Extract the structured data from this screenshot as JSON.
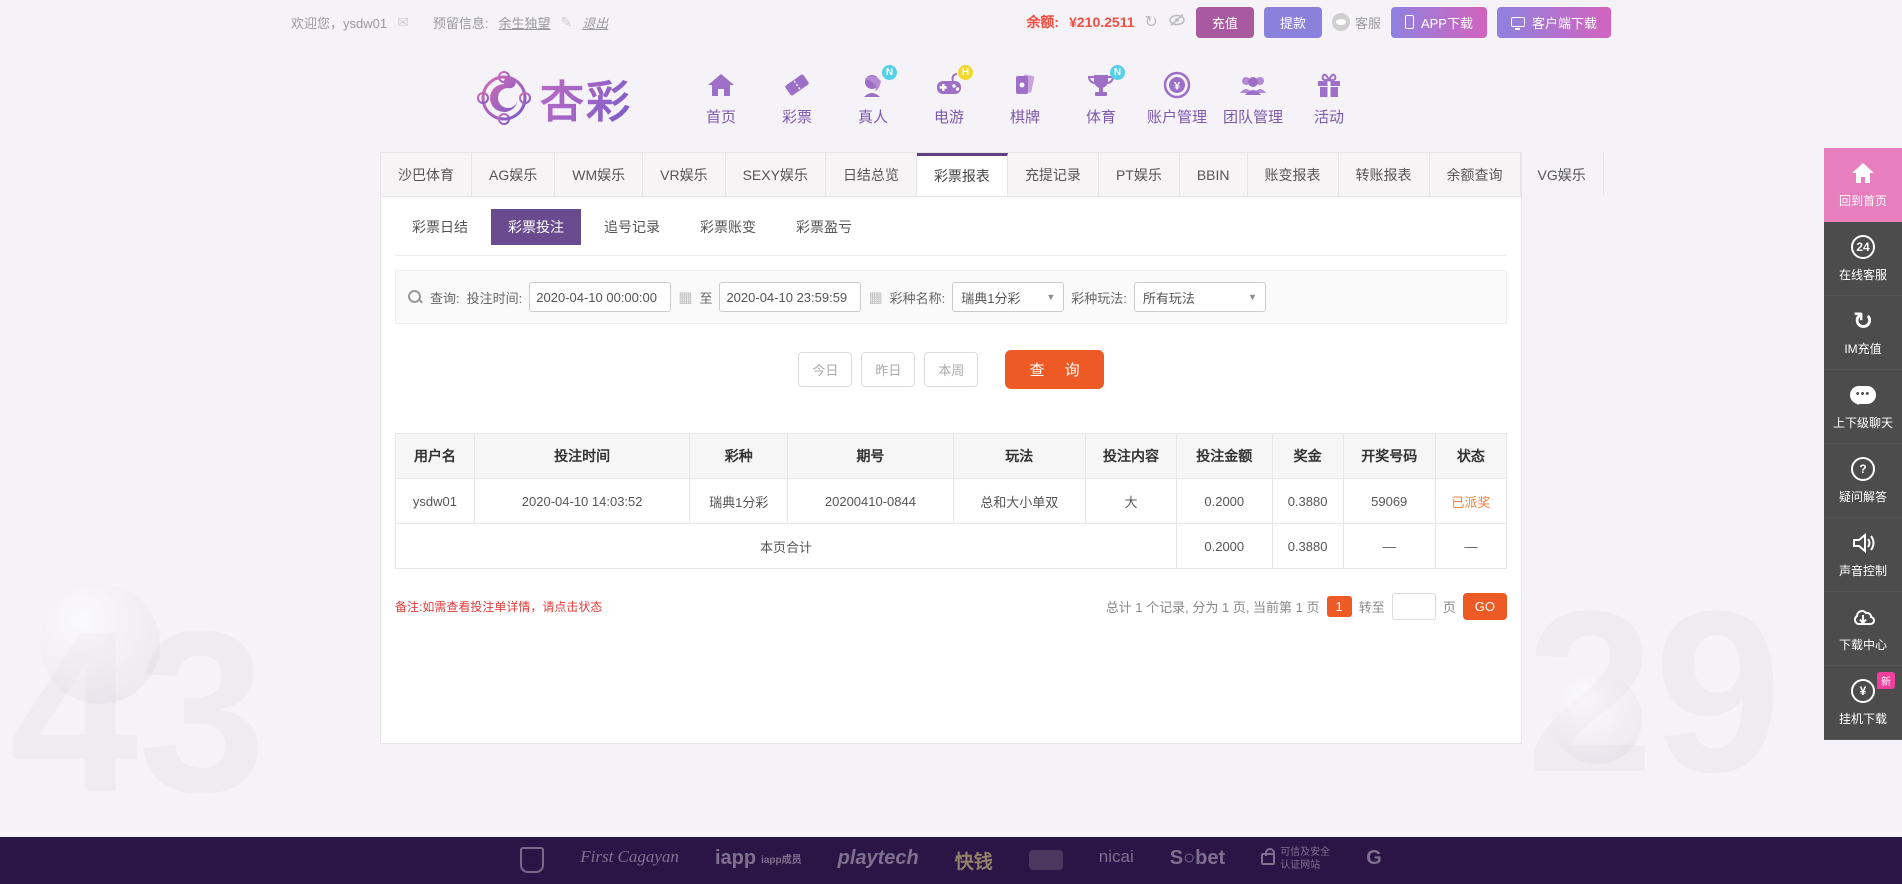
{
  "colors": {
    "accent_orange": "#ed5a26",
    "brand_purple": "#6a4b8f",
    "tab_active_border": "#5e4083",
    "balance_red": "#f34e42",
    "sidebar_pink": "#e77fbe",
    "deposit_btn": "#a9599f",
    "withdraw_btn": "#8b80dc",
    "status_orange": "#ef8240",
    "footer_bg": "#2b1546"
  },
  "topbar": {
    "welcome": "欢迎您，ysdw01",
    "reserved_label": "预留信息:",
    "reserved_value": "余生独望",
    "logout": "退出",
    "balance_label": "余额:",
    "balance_value": "¥210.2511",
    "deposit": "充值",
    "withdraw": "提款",
    "service": "客服",
    "app_download": "APP下载",
    "client_download": "客户端下载"
  },
  "brand": {
    "name": "杏彩"
  },
  "nav": {
    "items": [
      {
        "label": "首页",
        "badge": ""
      },
      {
        "label": "彩票",
        "badge": ""
      },
      {
        "label": "真人",
        "badge": "N"
      },
      {
        "label": "电游",
        "badge": "H"
      },
      {
        "label": "棋牌",
        "badge": ""
      },
      {
        "label": "体育",
        "badge": "N"
      },
      {
        "label": "账户管理",
        "badge": ""
      },
      {
        "label": "团队管理",
        "badge": ""
      },
      {
        "label": "活动",
        "badge": ""
      }
    ]
  },
  "tabs": {
    "items": [
      "沙巴体育",
      "AG娱乐",
      "WM娱乐",
      "VR娱乐",
      "SEXY娱乐",
      "日结总览",
      "彩票报表",
      "充提记录",
      "PT娱乐",
      "BBIN",
      "账变报表",
      "转账报表",
      "余额查询",
      "VG娱乐"
    ],
    "active": "彩票报表"
  },
  "subtabs": {
    "items": [
      "彩票日结",
      "彩票投注",
      "追号记录",
      "彩票账变",
      "彩票盈亏"
    ],
    "active": "彩票投注"
  },
  "query": {
    "query_label": "查询:",
    "time_label": "投注时间:",
    "time_from": "2020-04-10 00:00:00",
    "to_label": "至",
    "time_to": "2020-04-10 23:59:59",
    "lottery_label": "彩种名称:",
    "lottery_value": "瑞典1分彩",
    "play_label": "彩种玩法:",
    "play_value": "所有玩法",
    "today": "今日",
    "yesterday": "昨日",
    "week": "本周",
    "search": "查 询"
  },
  "table": {
    "headers": [
      "用户名",
      "投注时间",
      "彩种",
      "期号",
      "玩法",
      "投注内容",
      "投注金额",
      "奖金",
      "开奖号码",
      "状态"
    ],
    "rows": [
      [
        "ysdw01",
        "2020-04-10 14:03:52",
        "瑞典1分彩",
        "20200410-0844",
        "总和大小单双",
        "大",
        "0.2000",
        "0.3880",
        "59069",
        "已派奖"
      ]
    ],
    "total_label": "本页合计",
    "total_amount": "0.2000",
    "total_prize": "0.3880",
    "total_draw": "—",
    "total_status": "—"
  },
  "note": "备注:如需查看投注单详情，请点击状态",
  "pagination": {
    "summary": "总计 1 个记录, 分为 1 页, 当前第 1 页",
    "page": "1",
    "goto_label": "转至",
    "unit_label": "页",
    "go": "GO"
  },
  "sidebar": {
    "items": [
      {
        "label": "回到首页"
      },
      {
        "label": "在线客服"
      },
      {
        "label": "IM充值"
      },
      {
        "label": "上下级聊天"
      },
      {
        "label": "疑问解答"
      },
      {
        "label": "声音控制"
      },
      {
        "label": "下载中心"
      },
      {
        "label": "挂机下载",
        "badge": "新"
      }
    ]
  },
  "footer": {
    "logos": {
      "cagayan": "First Cagayan",
      "iapp": "iapp",
      "iapp_member": "iapp成员",
      "playtech": "playtech",
      "kuaiqian": "快钱",
      "nicai": "nicai",
      "sbet": "S○bet",
      "secure1": "可信及安全",
      "secure2": "认证网站",
      "g": "G"
    }
  }
}
